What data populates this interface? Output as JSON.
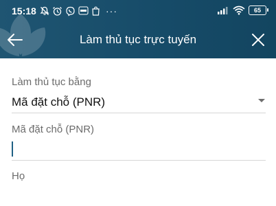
{
  "status_bar": {
    "time": "15:18",
    "icons": [
      "mute-bell-icon",
      "alarm-icon",
      "viber-icon",
      "zalo-icon",
      "shopee-icon"
    ],
    "more": "···",
    "battery": "65"
  },
  "header": {
    "title": "Làm thủ tục trực tuyến",
    "back_icon": "arrow-left-icon",
    "close_icon": "close-icon"
  },
  "form": {
    "method_label": "Làm thủ tục bằng",
    "method_value": "Mã đặt chỗ (PNR)",
    "pnr_label": "Mã đặt chỗ (PNR)",
    "pnr_value": "",
    "last_name_label": "Họ"
  },
  "colors": {
    "header_bg": "#1a4e6b",
    "cursor": "#1e5f83"
  }
}
